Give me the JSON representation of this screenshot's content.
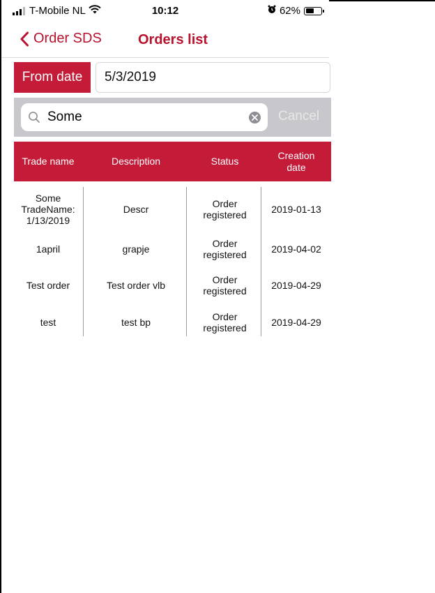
{
  "status_bar": {
    "carrier": "T-Mobile NL",
    "time": "10:12",
    "battery": "62%",
    "battery_level": 0.62
  },
  "nav": {
    "back_label": "Order SDS",
    "title": "Orders list"
  },
  "filter": {
    "from_label": "From date",
    "from_value": "5/3/2019"
  },
  "search": {
    "value": "Some",
    "cancel_label": "Cancel"
  },
  "table": {
    "headers": [
      "Trade name",
      "Description",
      "Status",
      "Creation date"
    ],
    "rows": [
      {
        "trade_name": "Some TradeName: 1/13/2019",
        "description": "Descr",
        "status": "Order registered",
        "date": "2019-01-13"
      },
      {
        "trade_name": "1april",
        "description": "grapje",
        "status": "Order registered",
        "date": "2019-04-02"
      },
      {
        "trade_name": "Test order",
        "description": "Test order vlb",
        "status": "Order registered",
        "date": "2019-04-29"
      },
      {
        "trade_name": "test",
        "description": "test bp",
        "status": "Order registered",
        "date": "2019-04-29"
      }
    ]
  },
  "colors": {
    "accent": "#c41b39",
    "nav_text": "#b8132e",
    "search_bg": "#c7c7cc"
  },
  "icons": [
    "signal-icon",
    "wifi-icon",
    "alarm-icon",
    "battery-icon",
    "chevron-left-icon",
    "search-icon",
    "clear-icon"
  ]
}
